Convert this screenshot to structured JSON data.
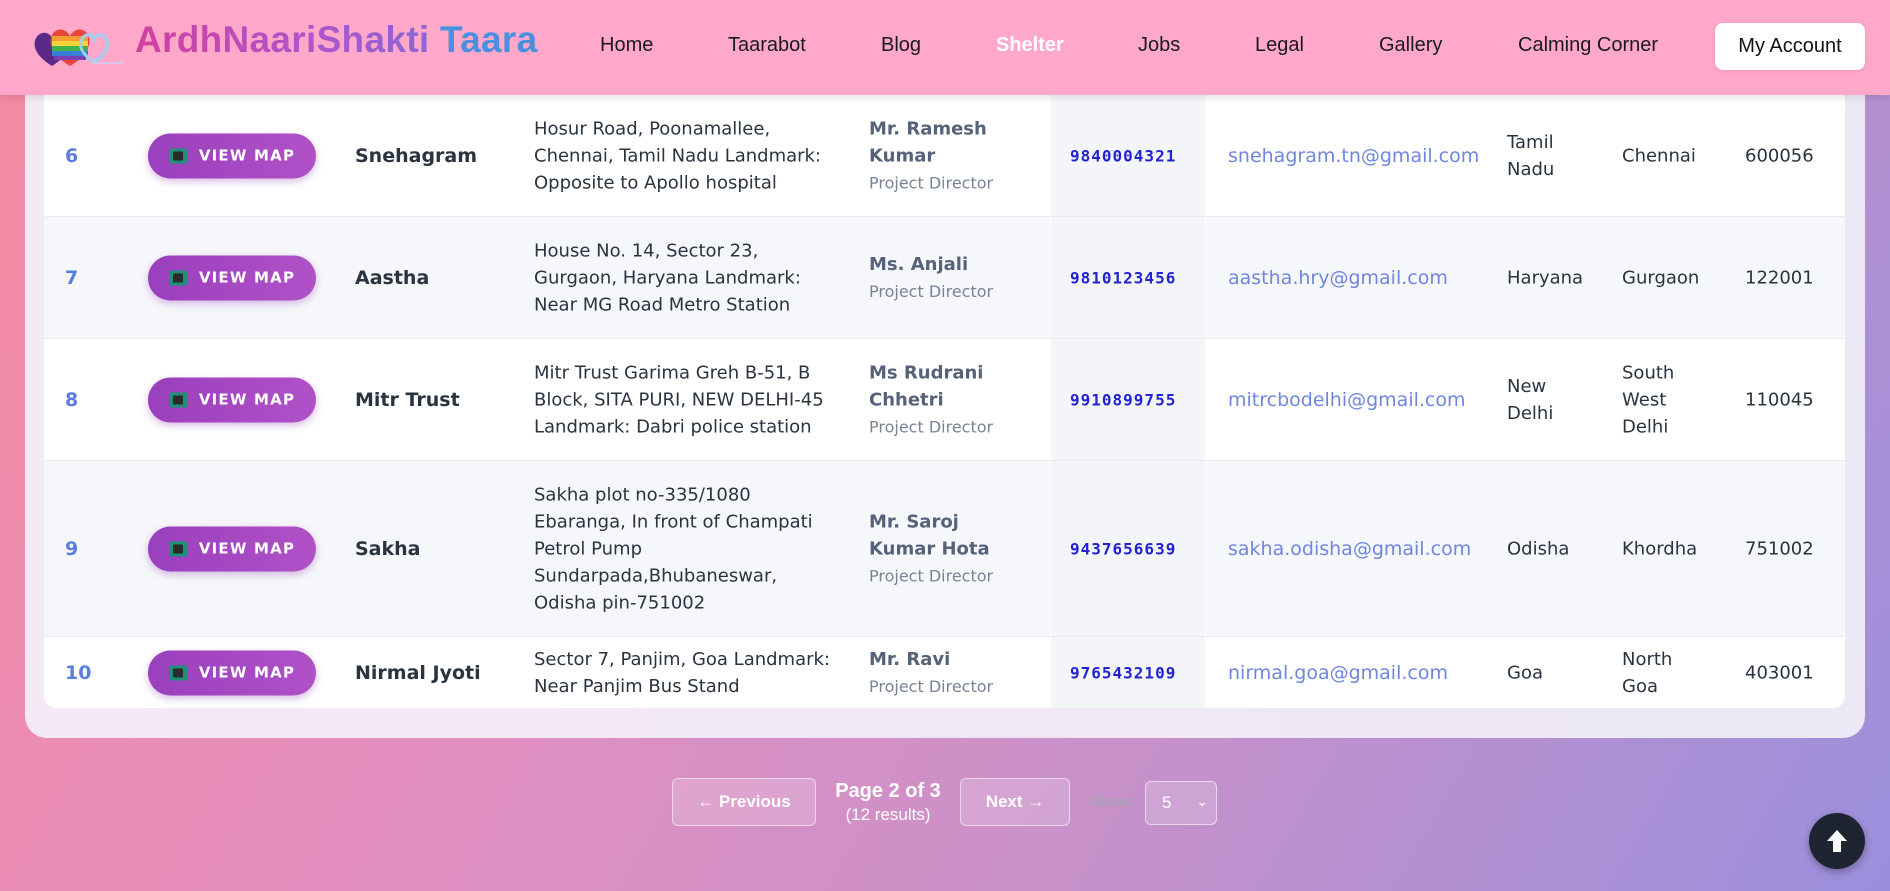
{
  "header": {
    "brand_part1": "ArdhNaariShakti",
    "brand_part2": "Taara",
    "nav": [
      {
        "label": "Home",
        "active": false
      },
      {
        "label": "Taarabot",
        "active": false
      },
      {
        "label": "Blog",
        "active": false
      },
      {
        "label": "Shelter",
        "active": true
      },
      {
        "label": "Jobs",
        "active": false
      },
      {
        "label": "Legal",
        "active": false
      },
      {
        "label": "Gallery",
        "active": false
      },
      {
        "label": "Calming Corner",
        "active": false
      }
    ],
    "account_label": "My Account"
  },
  "table": {
    "view_map_label": "VIEW MAP",
    "rows": [
      {
        "no": "6",
        "name": "Snehagram",
        "address": "Hosur Road, Poonamallee, Chennai, Tamil Nadu Landmark: Opposite to Apollo hospital",
        "contact_name": "Mr. Ramesh Kumar",
        "contact_role": "Project Director",
        "phone": "9840004321",
        "email": "snehagram.tn@gmail.com",
        "state": "Tamil Nadu",
        "city": "Chennai",
        "pincode": "600056"
      },
      {
        "no": "7",
        "name": "Aastha",
        "address": "House No. 14, Sector 23, Gurgaon, Haryana Landmark: Near MG Road Metro Station",
        "contact_name": "Ms. Anjali",
        "contact_role": "Project Director",
        "phone": "9810123456",
        "email": "aastha.hry@gmail.com",
        "state": "Haryana",
        "city": "Gurgaon",
        "pincode": "122001"
      },
      {
        "no": "8",
        "name": "Mitr Trust",
        "address": "Mitr Trust Garima Greh B-51, B Block, SITA PURI, NEW DELHI-45 Landmark: Dabri police station",
        "contact_name": "Ms Rudrani Chhetri",
        "contact_role": "Project Director",
        "phone": "9910899755",
        "email": "mitrcbodelhi@gmail.com",
        "state": "New Delhi",
        "city": "South West Delhi",
        "pincode": "110045"
      },
      {
        "no": "9",
        "name": "Sakha",
        "address": "Sakha plot no-335/1080 Ebaranga, In front of Champati Petrol Pump Sundarpada,Bhubaneswar, Odisha pin-751002",
        "contact_name": "Mr. Saroj Kumar Hota",
        "contact_role": "Project Director",
        "phone": "9437656639",
        "email": "sakha.odisha@gmail.com",
        "state": "Odisha",
        "city": "Khordha",
        "pincode": "751002"
      },
      {
        "no": "10",
        "name": "Nirmal Jyoti",
        "address": "Sector 7, Panjim, Goa Landmark: Near Panjim Bus Stand",
        "contact_name": "Mr. Ravi",
        "contact_role": "Project Director",
        "phone": "9765432109",
        "email": "nirmal.goa@gmail.com",
        "state": "Goa",
        "city": "North Goa",
        "pincode": "403001"
      }
    ]
  },
  "pagination": {
    "previous_label": "← Previous",
    "page_info": "Page 2 of 3",
    "results_info": "(12 results)",
    "next_label": "Next →",
    "show_label": "Show:",
    "page_size": "5"
  },
  "icons": {
    "map": "map-book-icon",
    "scroll_top": "arrow-up-icon"
  },
  "colors": {
    "header_bg": "#ffa8ca",
    "map_button": "#9a3fbd",
    "active_nav": "#ffffff",
    "row_number": "#5b7ce0",
    "phone": "#2222d0",
    "email": "#6f86de"
  }
}
